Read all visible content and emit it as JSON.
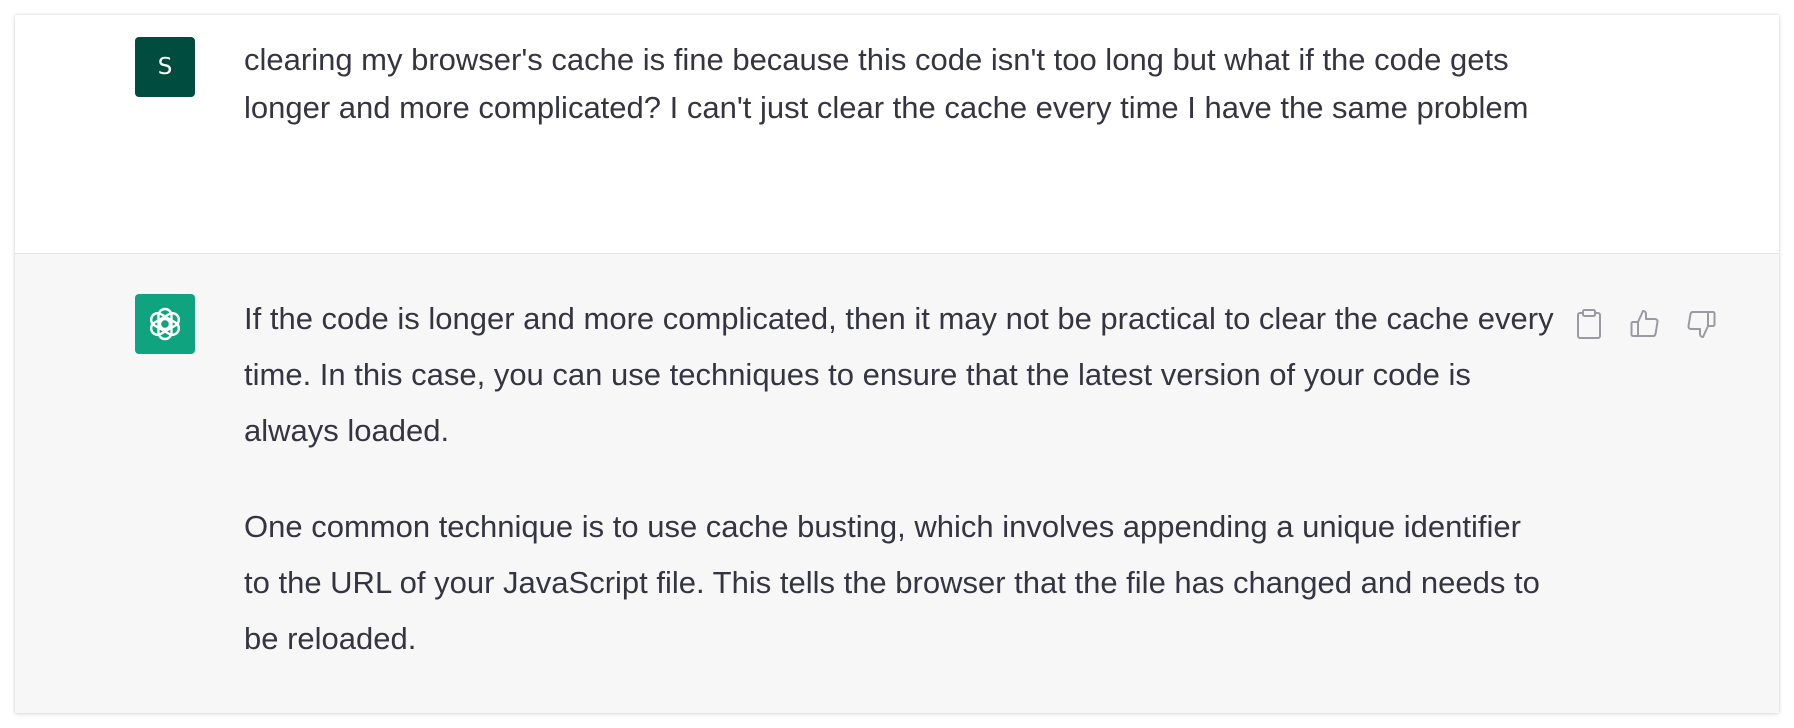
{
  "colors": {
    "user_avatar_bg": "#004d3f",
    "assistant_avatar_bg": "#10a37f",
    "assistant_row_bg": "#f7f7f8",
    "text": "#343541",
    "icon": "#9a9aa3"
  },
  "conversation": {
    "user_message": {
      "avatar_letter": "S",
      "text": "clearing my browser's cache is fine because this code isn't too long but what if the code gets longer and more complicated? I can't just clear the cache every time I have the same problem"
    },
    "assistant_message": {
      "avatar_icon": "openai-logo-icon",
      "paragraphs": [
        "If the code is longer and more complicated, then it may not be practical to clear the cache every time. In this case, you can use techniques to ensure that the latest version of your code is always loaded.",
        "One common technique is to use cache busting, which involves appending a unique identifier to the URL of your JavaScript file. This tells the browser that the file has changed and needs to be reloaded."
      ],
      "actions": [
        {
          "name": "copy",
          "icon": "clipboard-icon"
        },
        {
          "name": "thumbs-up",
          "icon": "thumbs-up-icon"
        },
        {
          "name": "thumbs-down",
          "icon": "thumbs-down-icon"
        }
      ]
    }
  }
}
